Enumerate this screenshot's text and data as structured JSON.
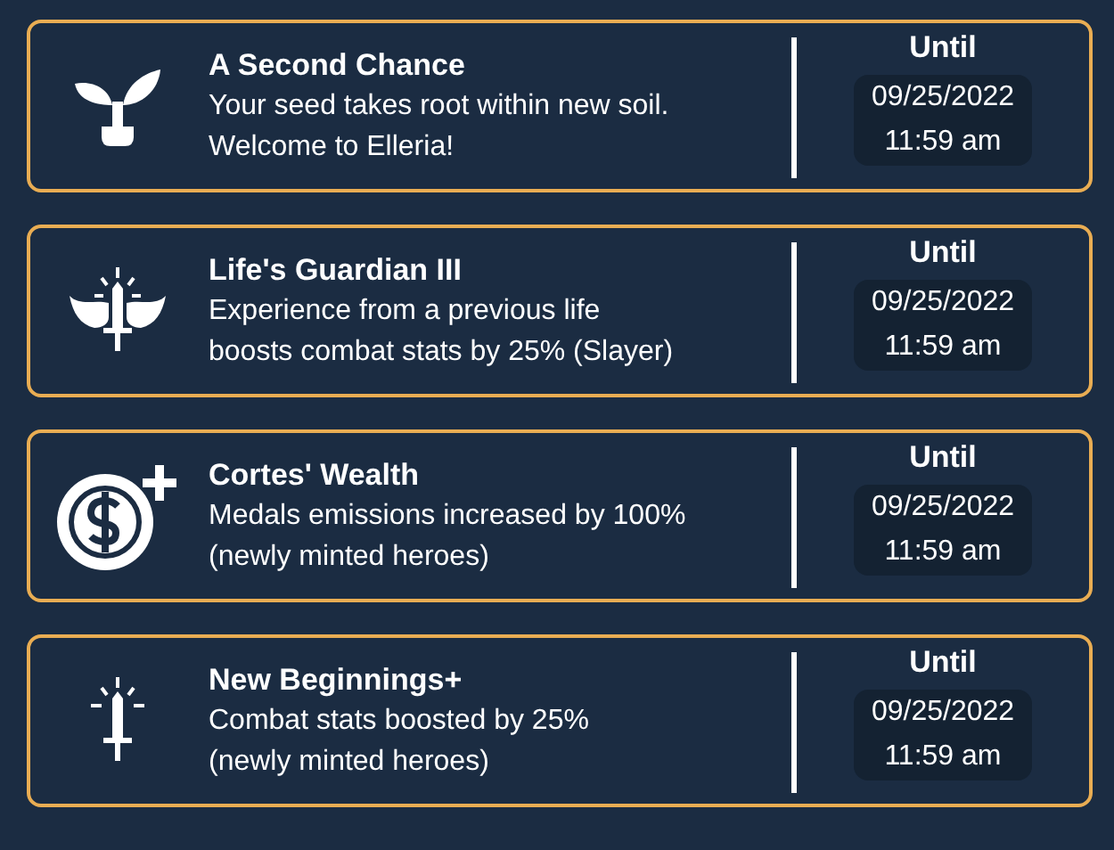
{
  "buffs": [
    {
      "kind": "sprout",
      "title": "A Second Chance",
      "description_lines": [
        "Your seed takes root within new soil.",
        "Welcome to Elleria!"
      ],
      "until_label": "Until",
      "date": "09/25/2022",
      "time": "11:59 am"
    },
    {
      "kind": "winged",
      "title": "Life's Guardian III",
      "description_lines": [
        "Experience from a previous life",
        "boosts combat stats by 25% (Slayer)"
      ],
      "until_label": "Until",
      "date": "09/25/2022",
      "time": "11:59 am"
    },
    {
      "kind": "coin",
      "title": "Cortes' Wealth",
      "description_lines": [
        "Medals emissions increased by 100%",
        "(newly minted heroes)"
      ],
      "until_label": "Until",
      "date": "09/25/2022",
      "time": "11:59 am"
    },
    {
      "kind": "sword",
      "title": "New Beginnings+",
      "description_lines": [
        "Combat stats boosted by 25%",
        "(newly minted heroes)"
      ],
      "until_label": "Until",
      "date": "09/25/2022",
      "time": "11:59 am"
    }
  ]
}
